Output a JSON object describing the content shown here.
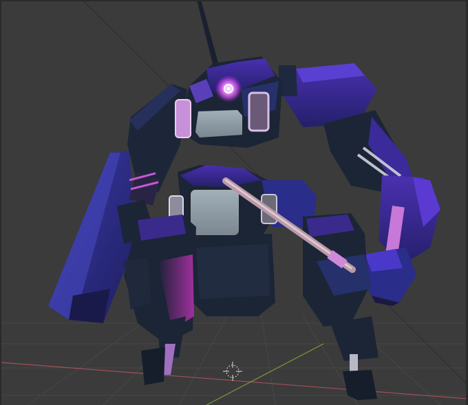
{
  "viewport": {
    "background": "#3b3b3b",
    "grid_color": "#474747",
    "x_axis_color": "#a0505a",
    "y_axis_color": "#7a9a3a",
    "subject": "robot-mech-model",
    "object_origin_marker": "3d-cursor-icon"
  },
  "colors": {
    "armor_dark": "#1b2536",
    "armor_navy": "#232e4a",
    "armor_purple": "#3a2a8c",
    "armor_violet": "#5a3ac8",
    "glow_magenta": "#c23cd6",
    "panel_gray": "#8d9aa4",
    "eye_glow": "#e27cff",
    "joint_metal": "#b8b8c8"
  }
}
